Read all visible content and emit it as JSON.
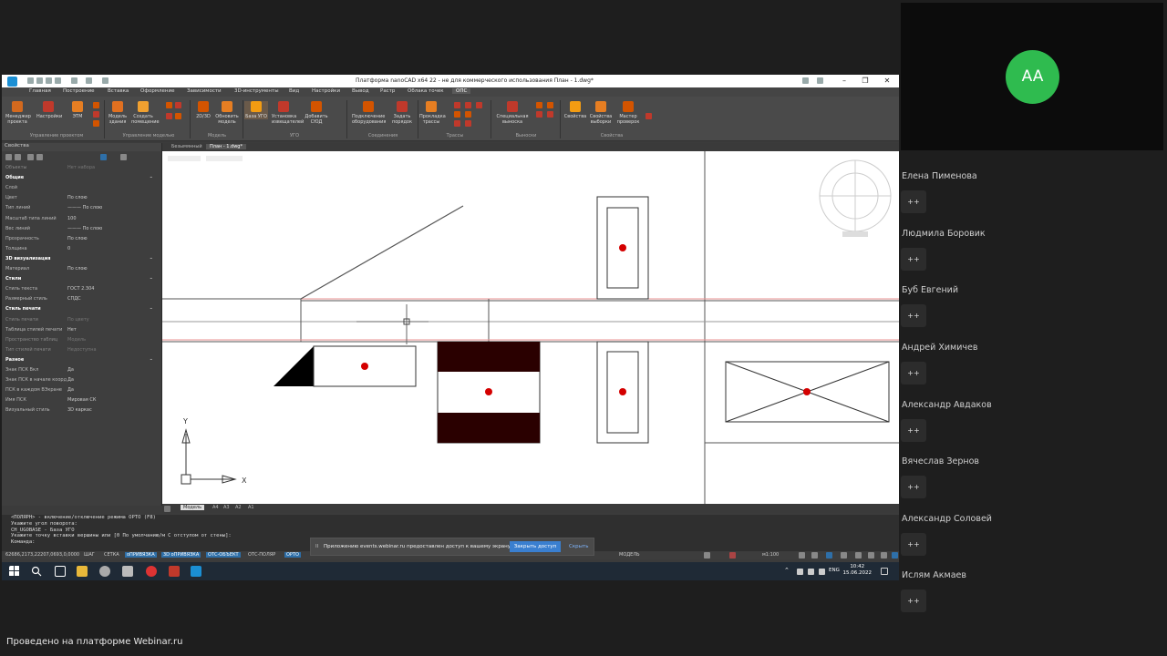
{
  "app": {
    "title": "Платформа nanoCAD x64 22 - не для коммерческого использования План - 1.dwg*",
    "window_controls": {
      "minimize": "–",
      "maximize": "❐",
      "close": "✕"
    }
  },
  "ribbon_tabs": [
    "Главная",
    "Построение",
    "Вставка",
    "Оформление",
    "Зависимости",
    "3D-инструменты",
    "Вид",
    "Настройки",
    "Вывод",
    "Растр",
    "Облака точек",
    "ОПС"
  ],
  "ribbon_active_tab": "ОПС",
  "ribbon_buttons": [
    "Менеджер проекта",
    "Настройки",
    "ЭТМ",
    "Модель здания",
    "Создать помещение",
    "2D/3D",
    "Обновить модель",
    "База УГО",
    "Установка извещателей",
    "Добавить СЮД",
    "Подключение оборудования",
    "Задать порядок",
    "Прокладка трассы",
    "Специальная выноска",
    "Свойства",
    "Свойства выборки",
    "Мастер проверок"
  ],
  "ribbon_groups": [
    "Управление проектом",
    "Управление моделью",
    "Модель",
    "УГО",
    "Соединения",
    "Трассы",
    "Выноски",
    "Свойства"
  ],
  "properties": {
    "title": "Свойства",
    "rows": [
      {
        "label": "Объекты",
        "value": "Нет набора",
        "type": "dim"
      },
      {
        "label": "Общие",
        "value": "",
        "type": "sec"
      },
      {
        "label": "Слой",
        "value": "",
        "type": "row"
      },
      {
        "label": "Цвет",
        "value": "По слою",
        "type": "row"
      },
      {
        "label": "Тип линий",
        "value": "——— По слою",
        "type": "row"
      },
      {
        "label": "Масштаб типа линий",
        "value": "100",
        "type": "row"
      },
      {
        "label": "Вес линий",
        "value": "——— По слою",
        "type": "row"
      },
      {
        "label": "Прозрачность",
        "value": "По слою",
        "type": "row"
      },
      {
        "label": "Толщина",
        "value": "0",
        "type": "row"
      },
      {
        "label": "3D визуализация",
        "value": "",
        "type": "sec"
      },
      {
        "label": "Материал",
        "value": "По слою",
        "type": "row"
      },
      {
        "label": "Стили",
        "value": "",
        "type": "sec"
      },
      {
        "label": "Стиль текста",
        "value": "ГОСТ 2.304",
        "type": "row"
      },
      {
        "label": "Размерный стиль",
        "value": "СПДС",
        "type": "row"
      },
      {
        "label": "Стиль печати",
        "value": "",
        "type": "sec"
      },
      {
        "label": "Стиль печати",
        "value": "По цвету",
        "type": "dim"
      },
      {
        "label": "Таблица стилей печати",
        "value": "Нет",
        "type": "row"
      },
      {
        "label": "Пространство таблиц",
        "value": "Модель",
        "type": "dim"
      },
      {
        "label": "Тип стилей печати",
        "value": "Недоступна",
        "type": "dim"
      },
      {
        "label": "Разное",
        "value": "",
        "type": "sec"
      },
      {
        "label": "Знак ПСК Вкл",
        "value": "Да",
        "type": "row"
      },
      {
        "label": "Знак ПСК в начале коорд",
        "value": "Да",
        "type": "row"
      },
      {
        "label": "ПСК в каждом ВЭкране",
        "value": "Да",
        "type": "row"
      },
      {
        "label": "Имя ПСК",
        "value": "Мировая СК",
        "type": "row"
      },
      {
        "label": "Визуальный стиль",
        "value": "3D каркас",
        "type": "row"
      }
    ]
  },
  "doc_tabs": [
    "Безымянный",
    "План - 1.dwg*"
  ],
  "layout_tabs": [
    "Модель",
    "A4",
    "A3",
    "A2",
    "A1"
  ],
  "ucs": {
    "x": "X",
    "y": "Y"
  },
  "command_lines": [
    "<ПОЛЯРН> - включение/отключение режима ОРТО (F8)",
    "Укажите угол поворота:",
    "CH_UGOBASE - База УГО",
    "Укажите точку вставки вершины или [0 По умолчанию/м С отступом от стены]:",
    "Команда:"
  ],
  "status_bar": {
    "coords": "62686,2173,22207,0693,0,0000",
    "toggles": [
      {
        "label": "ШАГ",
        "on": false
      },
      {
        "label": "СЕТКА",
        "on": false
      },
      {
        "label": "оПРИВЯЗКА",
        "on": true
      },
      {
        "label": "3D оПРИВЯЗКА",
        "on": true
      },
      {
        "label": "ОТС-ОБЪЕКТ",
        "on": true
      },
      {
        "label": "ОТС-ПОЛЯР",
        "on": false
      },
      {
        "label": "ОРТО",
        "on": true
      }
    ],
    "mode": "МОДЕЛЬ",
    "scale": "м1:100"
  },
  "notice": {
    "text": "Приложению events.webinar.ru предоставлен доступ к вашему экрану.",
    "primary": "Закрыть доступ",
    "secondary": "Скрыть",
    "pause": "II"
  },
  "taskbar": {
    "lang": "ENG",
    "time": "10:42",
    "date": "15.06.2022"
  },
  "participants": {
    "avatar_initials": "AA",
    "avatar_color": "#2fbb4f",
    "people": [
      {
        "name": "Елена Пименова",
        "action": "++"
      },
      {
        "name": "Людмила Боровик",
        "action": "++"
      },
      {
        "name": "Буб Евгений",
        "action": "++"
      },
      {
        "name": "Андрей Химичев",
        "action": "++"
      },
      {
        "name": "Александр Авдаков",
        "action": "++"
      },
      {
        "name": "Вячеслав Зернов",
        "action": "++"
      },
      {
        "name": "Александр Соловей",
        "action": "++"
      },
      {
        "name": "Ислям Акмаев",
        "action": "++"
      }
    ]
  },
  "footer": "Проведено на платформе Webinar.ru"
}
